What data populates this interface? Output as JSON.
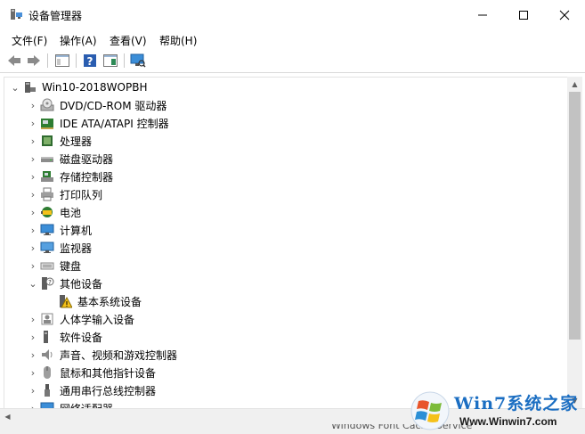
{
  "window": {
    "title": "设备管理器",
    "minimize": "—",
    "maximize": "☐",
    "close": "✕"
  },
  "menu": [
    "文件(F)",
    "操作(A)",
    "查看(V)",
    "帮助(H)"
  ],
  "tree": {
    "root": "Win10-2018WOPBH",
    "items": [
      {
        "label": "DVD/CD-ROM 驱动器",
        "icon": "dvd-drive-icon"
      },
      {
        "label": "IDE ATA/ATAPI 控制器",
        "icon": "ide-controller-icon"
      },
      {
        "label": "处理器",
        "icon": "processor-icon"
      },
      {
        "label": "磁盘驱动器",
        "icon": "disk-drive-icon"
      },
      {
        "label": "存储控制器",
        "icon": "storage-controller-icon"
      },
      {
        "label": "打印队列",
        "icon": "printer-icon"
      },
      {
        "label": "电池",
        "icon": "battery-icon"
      },
      {
        "label": "计算机",
        "icon": "computer-icon"
      },
      {
        "label": "监视器",
        "icon": "monitor-icon"
      },
      {
        "label": "键盘",
        "icon": "keyboard-icon"
      },
      {
        "label": "其他设备",
        "icon": "other-devices-icon",
        "expanded": true
      },
      {
        "label": "基本系统设备",
        "icon": "warning-device-icon",
        "child": true
      },
      {
        "label": "人体学输入设备",
        "icon": "hid-icon"
      },
      {
        "label": "软件设备",
        "icon": "software-device-icon"
      },
      {
        "label": "声音、视频和游戏控制器",
        "icon": "sound-icon"
      },
      {
        "label": "鼠标和其他指针设备",
        "icon": "mouse-icon"
      },
      {
        "label": "通用串行总线控制器",
        "icon": "usb-icon"
      },
      {
        "label": "网络适配器",
        "icon": "network-adapter-icon"
      }
    ]
  },
  "status": {
    "text": "Windows Font Cache Service"
  },
  "watermark": {
    "brand": "Win7系统之家",
    "url": "Www.Winwin7.com"
  }
}
